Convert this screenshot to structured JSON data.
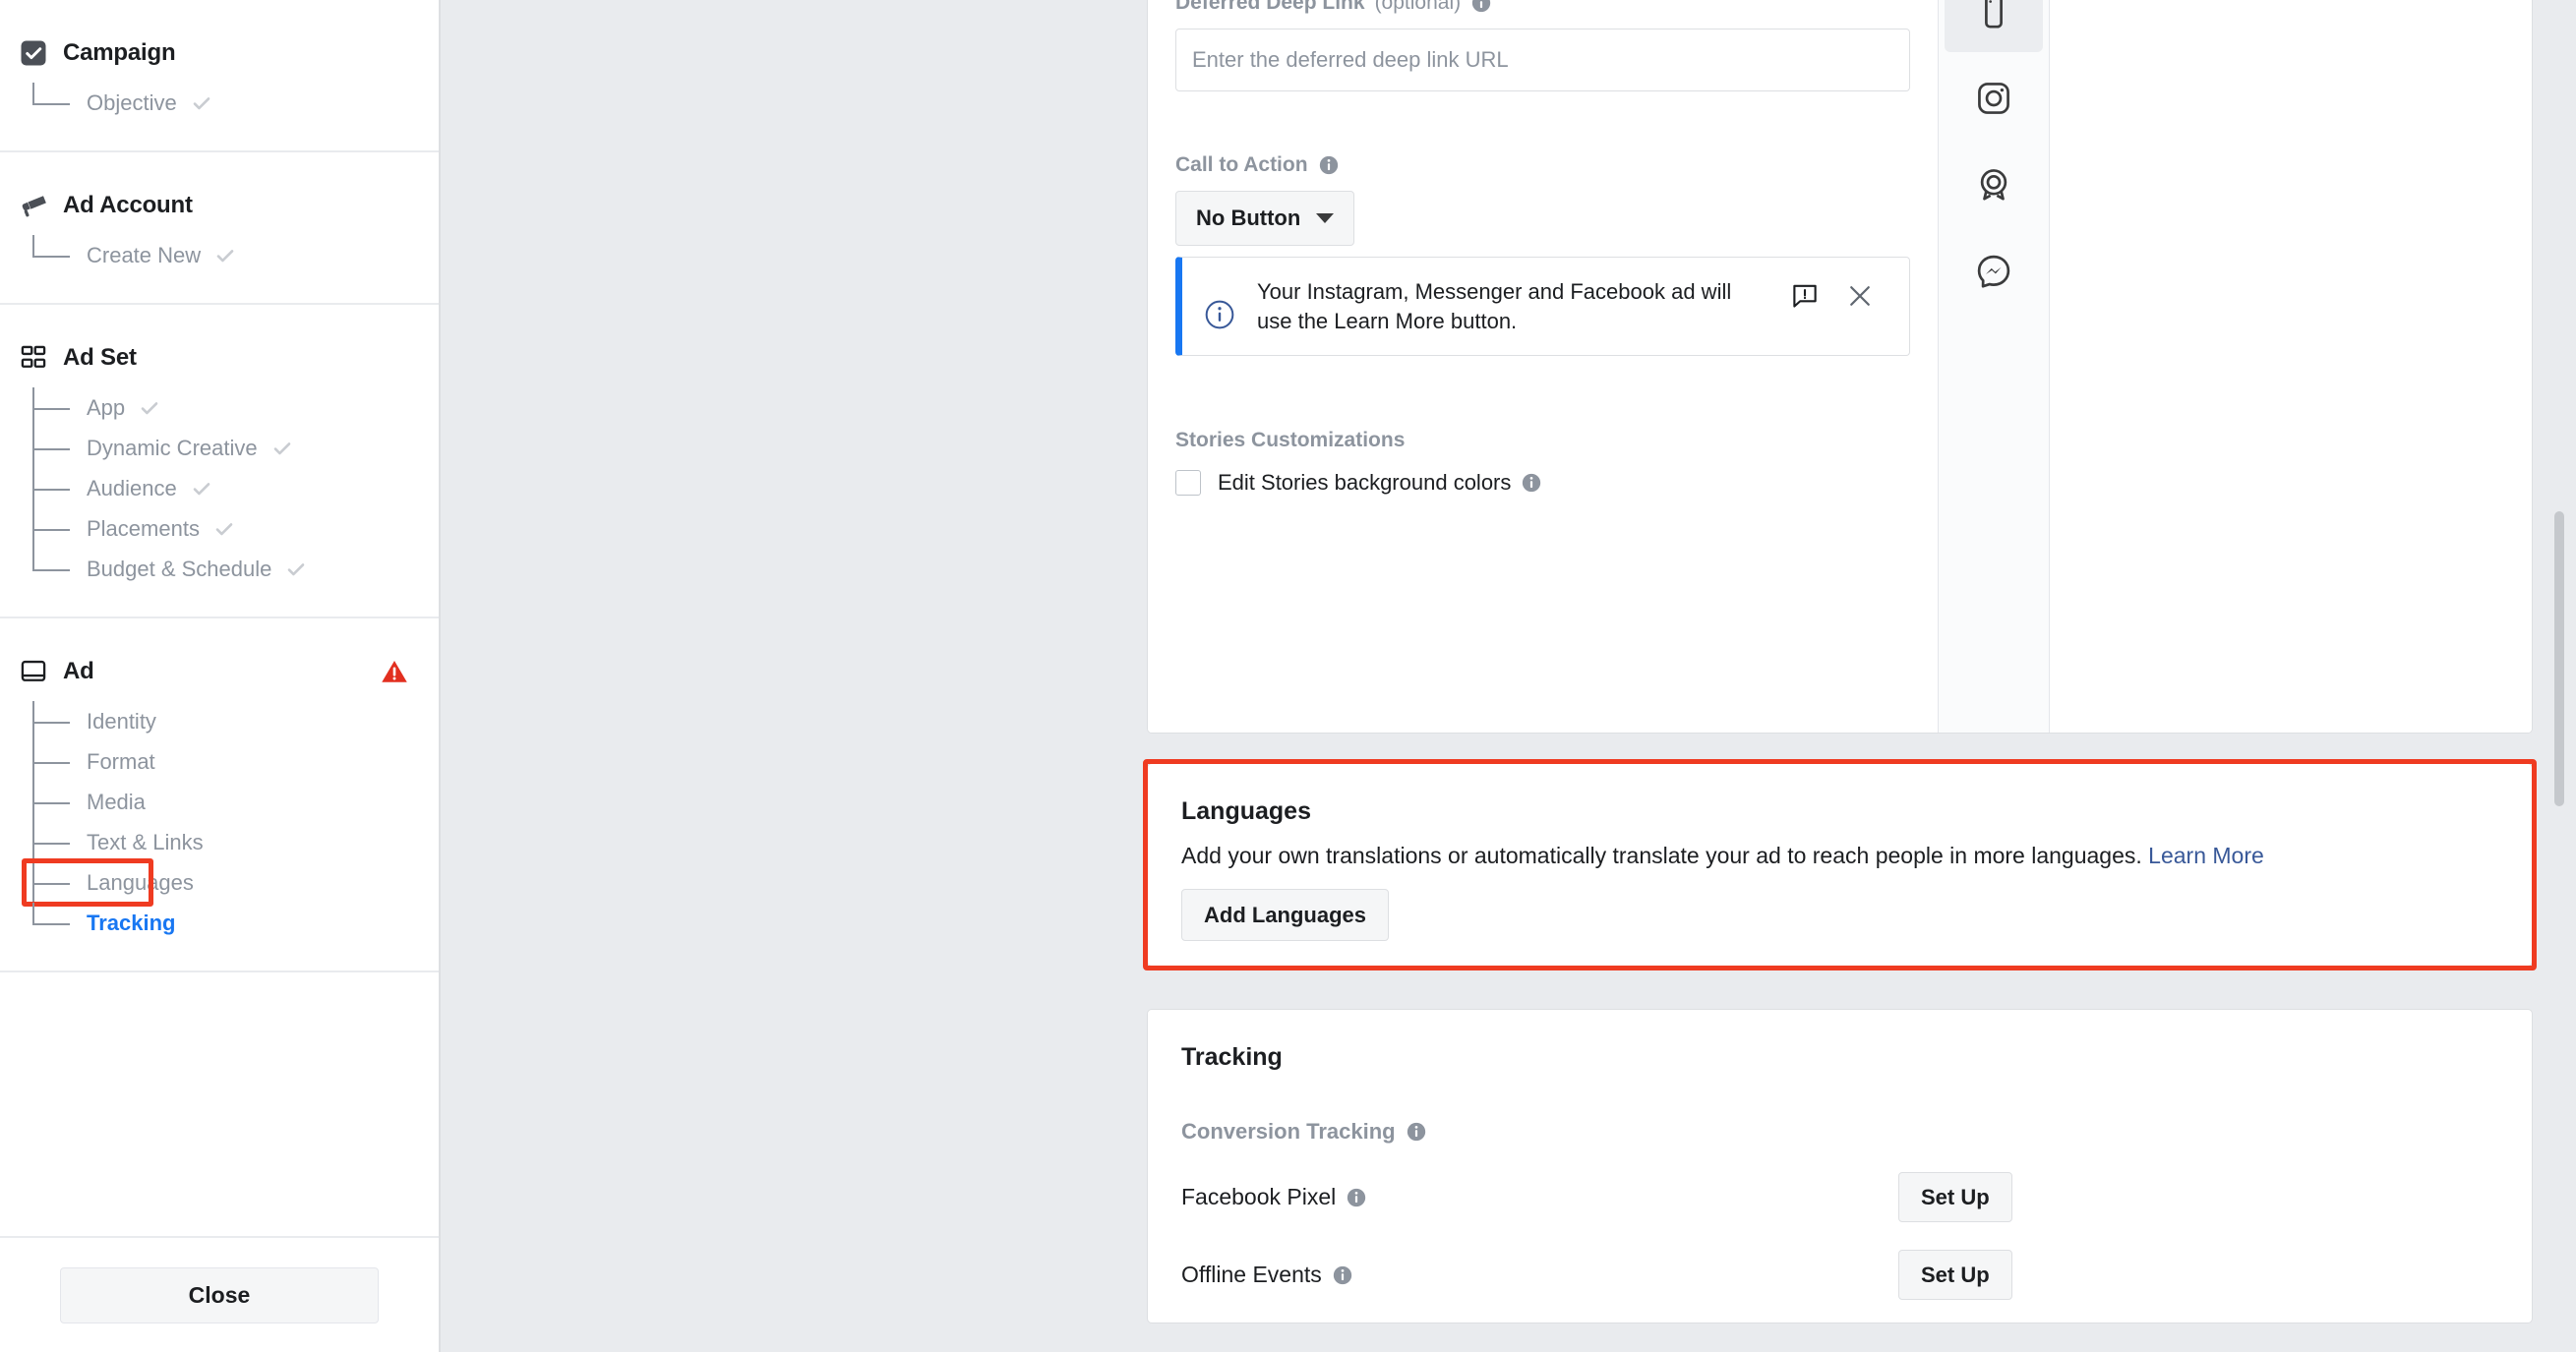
{
  "sidebar": {
    "groups": [
      {
        "title": "Campaign",
        "icon": "checkbox-filled-icon",
        "warning": false,
        "children": [
          {
            "label": "Objective",
            "checked": true,
            "active": false,
            "highlighted": false
          }
        ]
      },
      {
        "title": "Ad Account",
        "icon": "megaphone-icon",
        "warning": false,
        "children": [
          {
            "label": "Create New",
            "checked": true,
            "active": false,
            "highlighted": false
          }
        ]
      },
      {
        "title": "Ad Set",
        "icon": "grid-icon",
        "warning": false,
        "children": [
          {
            "label": "App",
            "checked": true,
            "active": false,
            "highlighted": false
          },
          {
            "label": "Dynamic Creative",
            "checked": true,
            "active": false,
            "highlighted": false
          },
          {
            "label": "Audience",
            "checked": true,
            "active": false,
            "highlighted": false
          },
          {
            "label": "Placements",
            "checked": true,
            "active": false,
            "highlighted": false
          },
          {
            "label": "Budget & Schedule",
            "checked": true,
            "active": false,
            "highlighted": false
          }
        ]
      },
      {
        "title": "Ad",
        "icon": "ad-window-icon",
        "warning": true,
        "warning_icon": "warning-triangle-icon",
        "children": [
          {
            "label": "Identity",
            "checked": false,
            "active": false,
            "highlighted": false
          },
          {
            "label": "Format",
            "checked": false,
            "active": false,
            "highlighted": false
          },
          {
            "label": "Media",
            "checked": false,
            "active": false,
            "highlighted": false
          },
          {
            "label": "Text & Links",
            "checked": false,
            "active": false,
            "highlighted": false
          },
          {
            "label": "Languages",
            "checked": false,
            "active": false,
            "highlighted": true
          },
          {
            "label": "Tracking",
            "checked": false,
            "active": true,
            "highlighted": false
          }
        ]
      }
    ],
    "close_label": "Close"
  },
  "form": {
    "deep_link": {
      "label": "Deferred Deep Link",
      "optional_suffix": "(optional)",
      "info_icon": "info-icon",
      "placeholder": "Enter the deferred deep link URL",
      "value": ""
    },
    "call_to_action": {
      "label": "Call to Action",
      "info_icon": "info-icon",
      "selected": "No Button",
      "caret_icon": "chevron-down-icon"
    },
    "banner": {
      "icon": "info-circle-icon",
      "text": "Your Instagram, Messenger and Facebook ad will use the Learn More button.",
      "feedback_icon": "feedback-flag-icon",
      "close_icon": "close-x-icon"
    },
    "stories": {
      "title": "Stories Customizations",
      "checkbox_label": "Edit Stories background colors",
      "checkbox_checked": false,
      "info_icon": "info-icon"
    }
  },
  "preview_rail": {
    "items": [
      {
        "icon": "mobile-phone-icon",
        "name": "mobile-preview",
        "selected": true
      },
      {
        "icon": "instagram-icon",
        "name": "instagram-preview",
        "selected": false
      },
      {
        "icon": "audience-network-icon",
        "name": "audience-network-preview",
        "selected": false
      },
      {
        "icon": "messenger-icon",
        "name": "messenger-preview",
        "selected": false
      }
    ]
  },
  "languages": {
    "title": "Languages",
    "description": "Add your own translations or automatically translate your ad to reach people in more languages.",
    "learn_more": "Learn More",
    "add_button": "Add Languages",
    "highlight_color": "#ef3b21"
  },
  "tracking": {
    "title": "Tracking",
    "conversion_label": "Conversion Tracking",
    "rows": [
      {
        "label": "Facebook Pixel",
        "info_icon": "info-icon",
        "action": "Set Up"
      },
      {
        "label": "Offline Events",
        "info_icon": "info-icon",
        "action": "Set Up"
      }
    ]
  },
  "colors": {
    "accent_blue": "#1877f2",
    "link_blue": "#385898",
    "highlight_red": "#ef3b21",
    "warning_red": "#e22f1f",
    "page_bg": "#e9ebee",
    "muted_text": "#8d949e"
  }
}
